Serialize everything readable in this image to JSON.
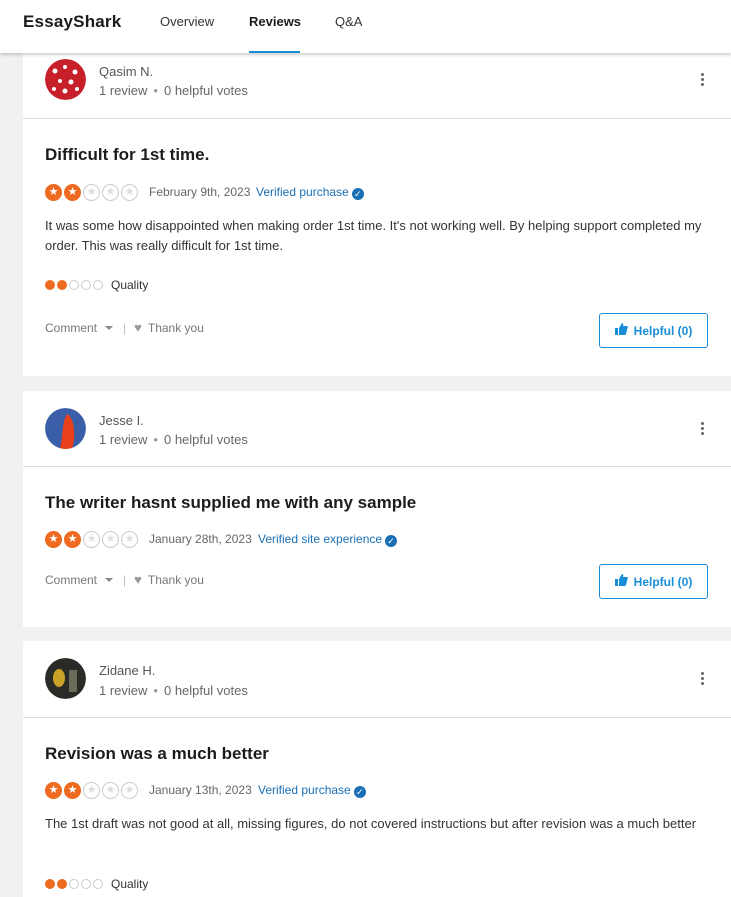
{
  "nav": {
    "brand": "EssayShark",
    "tabs": [
      "Overview",
      "Reviews",
      "Q&A"
    ],
    "active_tab": "Reviews"
  },
  "reviews": [
    {
      "name": "Qasim N.",
      "review_count": "1 review",
      "helpful_votes": "0 helpful votes",
      "title": "Difficult for 1st time.",
      "rating": 2,
      "date": "February 9th, 2023",
      "verified": "Verified purchase",
      "body": "It was some how disappointed when making order 1st time. It's not working well. By helping support completed my order. This was really difficult for 1st time.",
      "quality_rating": 2,
      "quality_label": "Quality",
      "comment_label": "Comment",
      "thank_label": "Thank you",
      "helpful_label": "Helpful (0)"
    },
    {
      "name": "Jesse I.",
      "review_count": "1 review",
      "helpful_votes": "0 helpful votes",
      "title": "The writer hasnt supplied me with any sample",
      "rating": 2,
      "date": "January 28th, 2023",
      "verified": "Verified site experience",
      "comment_label": "Comment",
      "thank_label": "Thank you",
      "helpful_label": "Helpful (0)"
    },
    {
      "name": "Zidane H.",
      "review_count": "1 review",
      "helpful_votes": "0 helpful votes",
      "title": "Revision was a much better",
      "rating": 2,
      "date": "January 13th, 2023",
      "verified": "Verified purchase",
      "body": "The 1st draft was not good at all, missing figures, do not covered instructions but after revision was a much better",
      "quality_rating": 2,
      "quality_label": "Quality"
    }
  ],
  "colors": {
    "accent": "#1a8dd8",
    "star": "#ef6a21",
    "verified": "#1a6fb5"
  }
}
